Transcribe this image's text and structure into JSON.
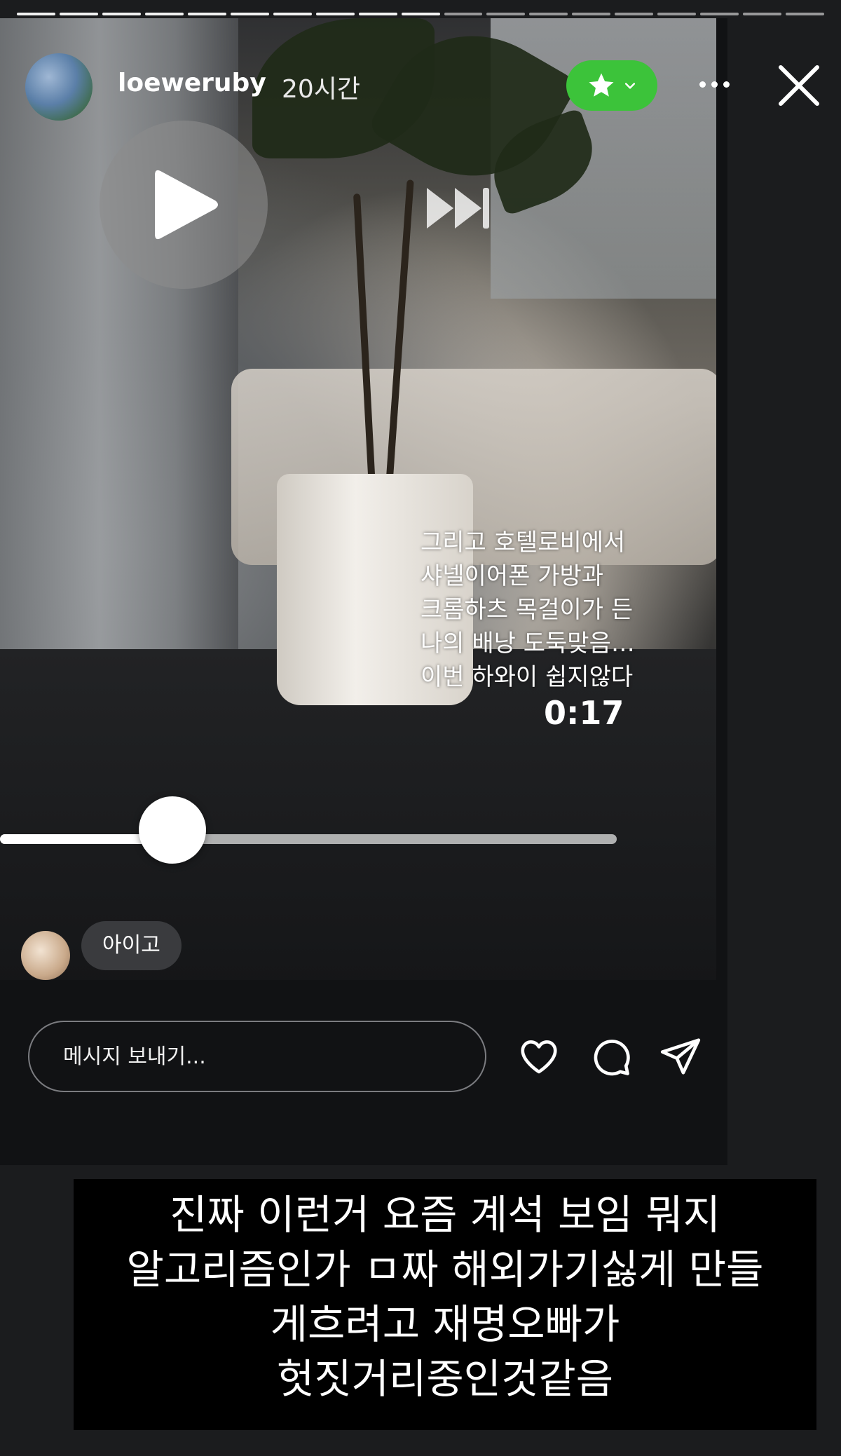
{
  "story": {
    "segments_total": 19,
    "segments_done": 10,
    "username": "loeweruby",
    "timestamp": "20시간",
    "icons": {
      "close_friends": "star-icon",
      "close_friends_chevron": "chevron-down-icon",
      "more": "more-dots-icon",
      "close": "close-icon",
      "play": "play-icon",
      "skip": "fast-forward-icon"
    },
    "colors": {
      "close_friends_badge": "#3cc33a",
      "background": "#1b1c1e",
      "panel": "#111214"
    }
  },
  "video": {
    "caption_lines": [
      "그리고 호텔로비에서",
      "샤넬이어폰 가방과",
      "크롬하츠 목걸이가 든",
      "나의 배낭 도둑맞음…",
      "이번 하와이 쉽지않다"
    ],
    "duration": "0:17",
    "seek_progress_fraction": 0.28
  },
  "reply": {
    "bubble_text": "아이고"
  },
  "footer": {
    "message_placeholder": "메시지 보내기...",
    "icons": {
      "like": "heart-icon",
      "comment": "comment-bubble-icon",
      "share": "send-icon"
    }
  },
  "comment": {
    "lines": [
      "진짜 이런거 요즘 계석 보임 뭐지",
      "알고리즘인가 ㅁ짜 해외가기싫게 만들",
      "게흐려고 재명오빠가",
      "헛짓거리중인것같음"
    ]
  }
}
